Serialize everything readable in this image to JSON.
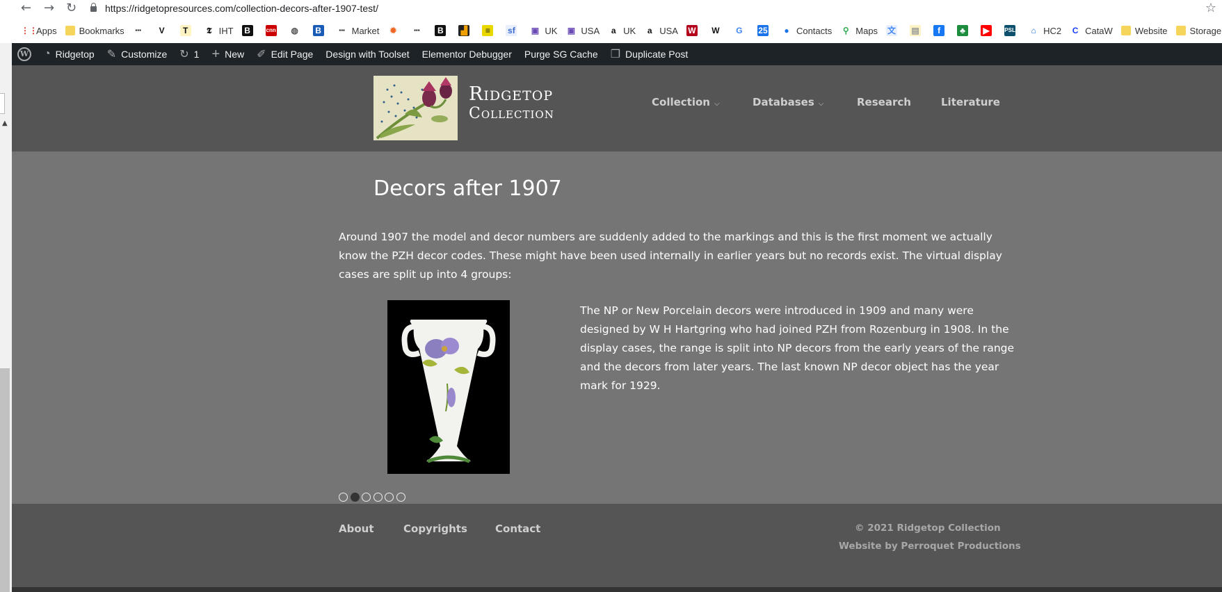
{
  "browser": {
    "url": "https://ridgetopresources.com/collection-decors-after-1907-test/",
    "bookmarks": [
      {
        "label": "Apps",
        "icon": "apps-grid-icon"
      },
      {
        "label": "Bookmarks",
        "icon": "folder-icon"
      },
      {
        "label": "",
        "icon": "bbc-icon"
      },
      {
        "label": "",
        "icon": "v-icon"
      },
      {
        "label": "",
        "icon": "t-icon"
      },
      {
        "label": "IHT",
        "icon": "nyt-icon"
      },
      {
        "label": "",
        "icon": "b-icon"
      },
      {
        "label": "",
        "icon": "cnn-icon"
      },
      {
        "label": "",
        "icon": "globe-icon"
      },
      {
        "label": "",
        "icon": "b-blue-icon"
      },
      {
        "label": "Market",
        "icon": "bbc-icon"
      },
      {
        "label": "",
        "icon": "orange-icon"
      },
      {
        "label": "",
        "icon": "bbc-icon"
      },
      {
        "label": "",
        "icon": "b-icon"
      },
      {
        "label": "",
        "icon": "chart-icon"
      },
      {
        "label": "",
        "icon": "stripes-icon"
      },
      {
        "label": "",
        "icon": "sf-icon"
      },
      {
        "label": "UK",
        "icon": "bag-icon"
      },
      {
        "label": "USA",
        "icon": "bag-icon"
      },
      {
        "label": "UK",
        "icon": "amazon-icon"
      },
      {
        "label": "USA",
        "icon": "amazon-icon"
      },
      {
        "label": "",
        "icon": "w-red-icon"
      },
      {
        "label": "",
        "icon": "wikipedia-icon"
      },
      {
        "label": "",
        "icon": "google-icon"
      },
      {
        "label": "",
        "icon": "calendar-icon"
      },
      {
        "label": "Contacts",
        "icon": "contacts-icon"
      },
      {
        "label": "Maps",
        "icon": "maps-icon"
      },
      {
        "label": "",
        "icon": "translate-icon"
      },
      {
        "label": "",
        "icon": "notes-icon"
      },
      {
        "label": "",
        "icon": "facebook-icon"
      },
      {
        "label": "",
        "icon": "green-icon"
      },
      {
        "label": "",
        "icon": "youtube-icon"
      },
      {
        "label": "",
        "icon": "psl-icon"
      },
      {
        "label": "HC2",
        "icon": "home-icon"
      },
      {
        "label": "CataW",
        "icon": "catawiki-icon"
      },
      {
        "label": "Website",
        "icon": "folder-icon"
      },
      {
        "label": "Storage",
        "icon": "folder-icon"
      }
    ]
  },
  "wp_admin_bar": {
    "site_name": "Ridgetop",
    "customize": "Customize",
    "updates_count": "1",
    "new": "New",
    "edit_page": "Edit Page",
    "toolset": "Design with Toolset",
    "elementor": "Elementor Debugger",
    "purge": "Purge SG Cache",
    "duplicate": "Duplicate Post"
  },
  "site": {
    "title_line1": "Ridgetop",
    "title_line2": "Collection",
    "nav": [
      {
        "label": "Collection",
        "has_dropdown": true
      },
      {
        "label": "Databases",
        "has_dropdown": true
      },
      {
        "label": "Research",
        "has_dropdown": false
      },
      {
        "label": "Literature",
        "has_dropdown": false
      }
    ]
  },
  "page": {
    "title": "Decors after 1907",
    "intro": "Around 1907 the model and decor numbers are suddenly added to the markings and this is the first moment we actually know the PZH decor codes. These might have been used internally in earlier years but no records exist. The virtual display cases are split up into 4 groups:",
    "np_text": "The NP or New Porcelain decors were introduced in 1909 and many were designed by W H Hartgring who had joined PZH from Rozenburg in 1908. In the display cases, the range is split into NP decors from the early years of the range and the decors from later years. The last known NP decor object has the year mark for 1929.",
    "slider": {
      "total": 6,
      "active": 2
    }
  },
  "footer": {
    "links": [
      "About",
      "Copyrights",
      "Contact"
    ],
    "copyright": "© 2021 Ridgetop Collection",
    "credit": "Website by Perroquet Productions"
  },
  "colors": {
    "header_bg": "#555555",
    "content_bg": "#757575",
    "admin_bar_bg": "#1d2327",
    "nav_text": "#cfcfcf"
  }
}
